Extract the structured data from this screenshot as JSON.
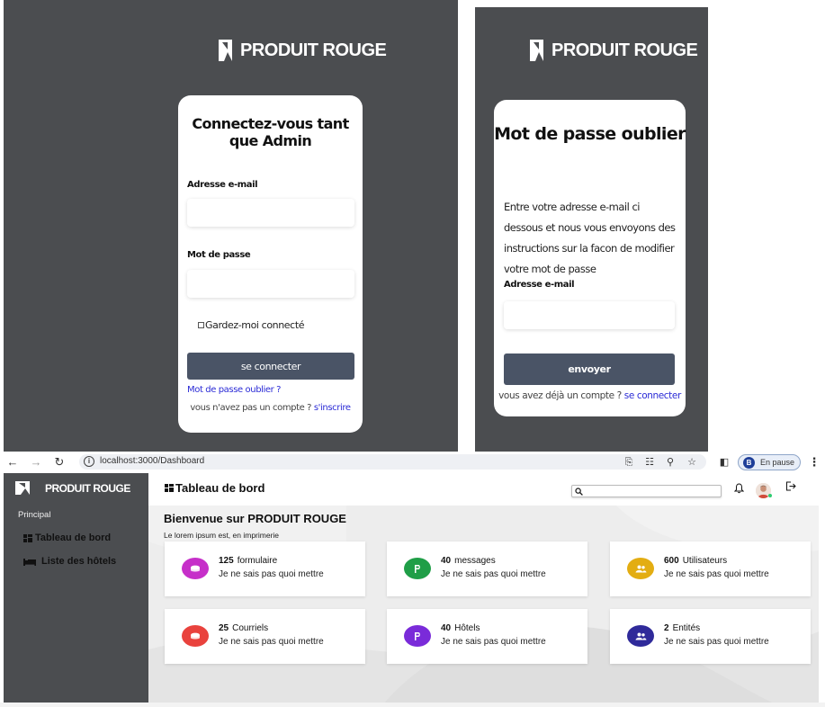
{
  "brand": {
    "name": "PRODUIT ROUGE"
  },
  "login": {
    "title": "Connectez-vous tant que Admin",
    "email_label": "Adresse e-mail",
    "password_label": "Mot de passe",
    "remember_label": "Gardez-moi connecté",
    "submit_label": "se connecter",
    "forgot_link": "Mot de passe oublier ?",
    "no_account_text": "vous n'avez pas un compte ?",
    "signup_link": "s'inscrire"
  },
  "forgot": {
    "title": "Mot de passe oublier",
    "instructions": "Entre votre adresse e-mail ci dessous et nous vous envoyons des instructions sur la facon de modifier votre mot de passe",
    "email_label": "Adresse e-mail",
    "submit_label": "envoyer",
    "have_account_text": "vous avez déjà un compte ?",
    "login_link": "se connecter"
  },
  "browser": {
    "url": "localhost:3000/Dashboard",
    "profile_initial": "B",
    "profile_status": "En pause"
  },
  "sidebar": {
    "section_label": "Principal",
    "items": [
      {
        "label": "Tableau de bord",
        "icon": "dashboard-icon"
      },
      {
        "label": "Liste des hôtels",
        "icon": "bed-icon"
      }
    ]
  },
  "dashboard": {
    "page_title": "Tableau de bord",
    "welcome": "Bienvenue sur PRODUIT ROUGE",
    "subtitle": "Le lorem ipsum est, en imprimerie",
    "cards": [
      {
        "count": "125",
        "label": "formulaire",
        "description": "Je ne sais pas quoi mettre",
        "color": "#c62fc9",
        "icon": "form-icon"
      },
      {
        "count": "40",
        "label": "messages",
        "description": "Je ne sais pas quoi mettre",
        "color": "#1f9e47",
        "icon": "p-icon"
      },
      {
        "count": "600",
        "label": "Utilisateurs",
        "description": "Je ne sais pas quoi mettre",
        "color": "#e3ad12",
        "icon": "users-icon"
      },
      {
        "count": "25",
        "label": "Courriels",
        "description": "Je ne sais pas quoi mettre",
        "color": "#e9423d",
        "icon": "mail-icon"
      },
      {
        "count": "40",
        "label": "Hôtels",
        "description": "Je ne sais pas quoi mettre",
        "color": "#7a2bd9",
        "icon": "p-icon"
      },
      {
        "count": "2",
        "label": "Entités",
        "description": "Je ne sais pas quoi mettre",
        "color": "#2f2a9a",
        "icon": "users-icon"
      }
    ]
  }
}
